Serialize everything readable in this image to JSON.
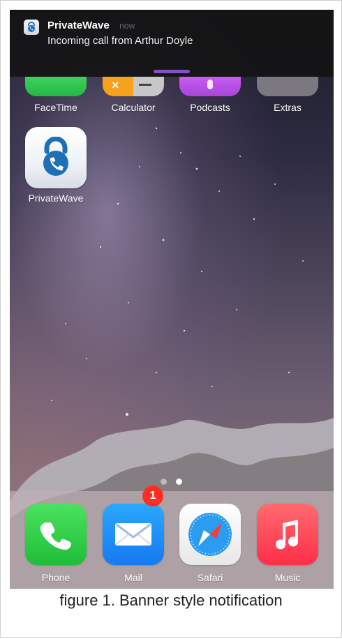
{
  "banner": {
    "app_name": "PrivateWave",
    "time": "now",
    "message": "Incoming call from Arthur Doyle"
  },
  "home_row_labels": [
    "FaceTime",
    "Calculator",
    "Podcasts",
    "Extras"
  ],
  "privatewave_label": "PrivateWave",
  "dock": {
    "labels": [
      "Phone",
      "Mail",
      "Safari",
      "Music"
    ],
    "mail_badge": "1"
  },
  "caption": "figure 1. Banner style notification",
  "colors": {
    "banner_handle": "#7d54c8",
    "badge": "#ff2d22"
  }
}
